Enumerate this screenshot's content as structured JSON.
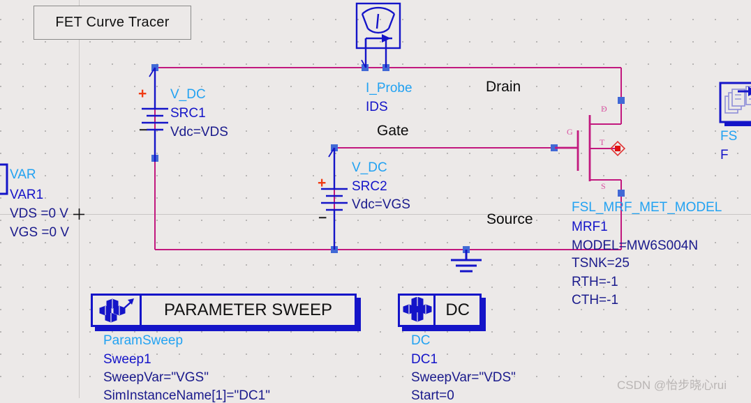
{
  "canvas": {
    "title_label": "FET Curve Tracer",
    "background_color": "#ece9e8",
    "wire_color": "#c2187e",
    "component_color": "#1414c8",
    "pin_color": "#d94fa0",
    "instance_name_color": "#22a2f2",
    "parameter_color": "#1a1a8c"
  },
  "var_block": {
    "icon": "var-block-icon",
    "type": "VAR",
    "instance": "VAR1",
    "params": [
      "VDS =0 V",
      "VGS =0 V"
    ]
  },
  "src1": {
    "icon": "dc-voltage-source-icon",
    "plus": "+",
    "minus": "−",
    "type": "V_DC",
    "instance": "SRC1",
    "params": [
      "Vdc=VDS"
    ]
  },
  "src2": {
    "icon": "dc-voltage-source-icon",
    "plus": "+",
    "minus": "−",
    "type": "V_DC",
    "instance": "SRC2",
    "params": [
      "Vdc=VGS"
    ]
  },
  "iprobe": {
    "icon": "current-probe-meter-icon",
    "type": "I_Probe",
    "instance": "IDS"
  },
  "ground": {
    "icon": "ground-icon"
  },
  "node_labels": {
    "drain": "Drain",
    "gate": "Gate",
    "source": "Source"
  },
  "transistor": {
    "icon": "mosfet-icon",
    "pins": {
      "drain": "D",
      "gate": "G",
      "thermal": "T",
      "source": "S"
    },
    "type": "FSL_MRF_MET_MODEL",
    "instance": "MRF1",
    "params": [
      "MODEL=MW6S004N",
      "TSNK=25",
      "RTH=-1",
      "CTH=-1"
    ]
  },
  "right_edge_block": {
    "icon": "model-stack-icon",
    "type": "FS",
    "instance": "F"
  },
  "param_sweep": {
    "icon": "parameter-sweep-icon",
    "header_label": "PARAMETER SWEEP",
    "type": "ParamSweep",
    "instance": "Sweep1",
    "params": [
      "SweepVar=\"VGS\"",
      "SimInstanceName[1]=\"DC1\""
    ]
  },
  "dc_sim": {
    "icon": "dc-simulation-icon",
    "header_label": "DC",
    "type": "DC",
    "instance": "DC1",
    "params": [
      "SweepVar=\"VDS\"",
      "Start=0"
    ]
  },
  "watermark": {
    "text": "CSDN @怡步晓心rui"
  }
}
